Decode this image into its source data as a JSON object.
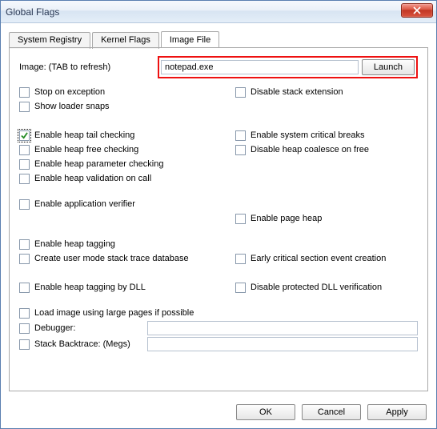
{
  "window": {
    "title": "Global Flags"
  },
  "tabs": {
    "system_registry": "System Registry",
    "kernel_flags": "Kernel Flags",
    "image_file": "Image File",
    "active_index": 2
  },
  "image_row": {
    "label": "Image: (TAB to refresh)",
    "value": "notepad.exe",
    "launch": "Launch"
  },
  "flags": {
    "stop_on_exception": "Stop on exception",
    "show_loader_snaps": "Show loader snaps",
    "disable_stack_extension": "Disable stack extension",
    "enable_heap_tail_checking": "Enable heap tail checking",
    "enable_heap_free_checking": "Enable heap free checking",
    "enable_heap_parameter_checking": "Enable heap parameter checking",
    "enable_heap_validation_on_call": "Enable heap validation on call",
    "enable_system_critical_breaks": "Enable system critical breaks",
    "disable_heap_coalesce_on_free": "Disable heap coalesce on free",
    "enable_application_verifier": "Enable application verifier",
    "enable_page_heap": "Enable page heap",
    "enable_heap_tagging": "Enable heap tagging",
    "create_user_mode_stack_trace_db": "Create user mode stack trace database",
    "early_critical_section_event_creation": "Early critical section event creation",
    "enable_heap_tagging_by_dll": "Enable heap tagging by DLL",
    "disable_protected_dll_verification": "Disable protected DLL verification",
    "load_image_large_pages": "Load image using large pages if possible",
    "debugger": "Debugger:",
    "stack_backtrace": "Stack Backtrace: (Megs)"
  },
  "checked": {
    "enable_heap_tail_checking": true
  },
  "buttons": {
    "ok": "OK",
    "cancel": "Cancel",
    "apply": "Apply"
  }
}
